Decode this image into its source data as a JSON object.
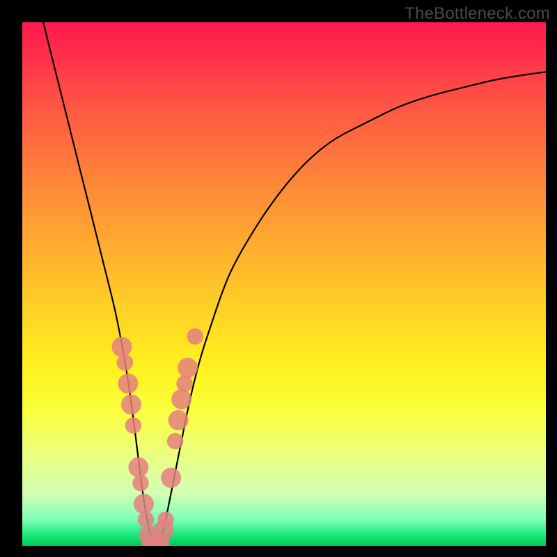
{
  "watermark": "TheBottleneck.com",
  "colors": {
    "frame": "#000000",
    "curve": "#000000",
    "marker": "#e48080",
    "gradient_stops": [
      {
        "pct": 0,
        "hex": "#ff1a4d"
      },
      {
        "pct": 6,
        "hex": "#ff2e4a"
      },
      {
        "pct": 12,
        "hex": "#ff4747"
      },
      {
        "pct": 22,
        "hex": "#ff6a3f"
      },
      {
        "pct": 32,
        "hex": "#ff8b37"
      },
      {
        "pct": 42,
        "hex": "#ffaa2f"
      },
      {
        "pct": 55,
        "hex": "#ffd226"
      },
      {
        "pct": 66,
        "hex": "#fff21e"
      },
      {
        "pct": 74,
        "hex": "#fbff3c"
      },
      {
        "pct": 82,
        "hex": "#ecff7a"
      },
      {
        "pct": 90,
        "hex": "#d2ffb3"
      },
      {
        "pct": 95,
        "hex": "#7dffb8"
      },
      {
        "pct": 98,
        "hex": "#18e87a"
      },
      {
        "pct": 100,
        "hex": "#00c853"
      }
    ]
  },
  "chart_data": {
    "type": "line",
    "title": "",
    "xlabel": "",
    "ylabel": "",
    "xlim": [
      0,
      100
    ],
    "ylim": [
      0,
      100
    ],
    "x": [
      4,
      6,
      8,
      10,
      12,
      14,
      16,
      18,
      20,
      21,
      22,
      23,
      24,
      25,
      26,
      27,
      28,
      30,
      32,
      34,
      36,
      38,
      40,
      44,
      48,
      52,
      56,
      60,
      66,
      72,
      78,
      84,
      90,
      96,
      100
    ],
    "y": [
      100,
      92,
      84,
      76,
      68,
      60,
      52,
      44,
      33,
      26,
      18,
      10,
      4,
      0,
      0,
      3,
      8,
      18,
      28,
      36,
      42,
      48,
      53,
      60,
      66,
      71,
      75,
      78,
      81,
      84,
      86,
      87.5,
      89,
      90,
      90.5
    ],
    "markers": [
      {
        "x": 19.0,
        "y": 38,
        "r": 1.4
      },
      {
        "x": 19.6,
        "y": 35,
        "r": 1.0
      },
      {
        "x": 20.2,
        "y": 31,
        "r": 1.4
      },
      {
        "x": 20.8,
        "y": 27,
        "r": 1.4
      },
      {
        "x": 21.2,
        "y": 23,
        "r": 1.0
      },
      {
        "x": 22.2,
        "y": 15,
        "r": 1.4
      },
      {
        "x": 22.6,
        "y": 12,
        "r": 1.0
      },
      {
        "x": 23.2,
        "y": 8,
        "r": 1.4
      },
      {
        "x": 23.6,
        "y": 5,
        "r": 1.0
      },
      {
        "x": 24.2,
        "y": 2,
        "r": 1.4
      },
      {
        "x": 24.8,
        "y": 0.5,
        "r": 1.4
      },
      {
        "x": 25.5,
        "y": 0,
        "r": 1.4
      },
      {
        "x": 26.2,
        "y": 0.5,
        "r": 1.4
      },
      {
        "x": 27.0,
        "y": 3,
        "r": 1.4
      },
      {
        "x": 27.4,
        "y": 5,
        "r": 1.0
      },
      {
        "x": 28.4,
        "y": 13,
        "r": 1.4
      },
      {
        "x": 29.2,
        "y": 20,
        "r": 1.0
      },
      {
        "x": 29.8,
        "y": 24,
        "r": 1.4
      },
      {
        "x": 30.4,
        "y": 28,
        "r": 1.4
      },
      {
        "x": 31.0,
        "y": 31,
        "r": 1.0
      },
      {
        "x": 31.6,
        "y": 34,
        "r": 1.4
      },
      {
        "x": 33.0,
        "y": 40,
        "r": 1.0
      }
    ]
  }
}
